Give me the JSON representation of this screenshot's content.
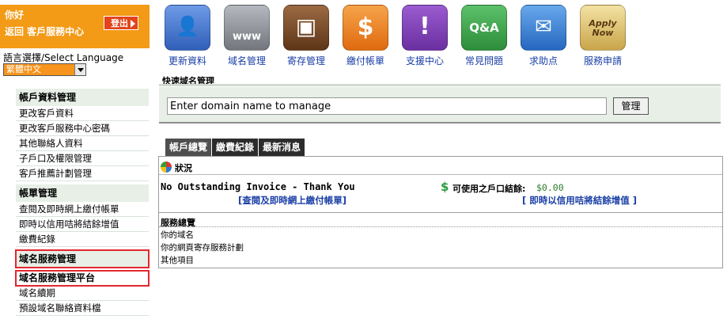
{
  "welcome": {
    "hello": "你好",
    "back_label": "返回 客戶服務中心",
    "logout_label": "登出"
  },
  "language": {
    "label": "語言選擇/Select Language",
    "selected": "繁體中文"
  },
  "sidebar": {
    "sections": [
      {
        "header": "帳戶資料管理",
        "items": [
          "更改客戶資料",
          "更改客戶服務中心密碼",
          "其他聯絡人資料",
          "子戶口及權限管理",
          "客戶推薦計劃管理"
        ]
      },
      {
        "header": "帳單管理",
        "items": [
          "查閱及即時網上繳付帳單",
          "即時以信用咭將結餘增值",
          "繳費紀錄"
        ]
      },
      {
        "header": "域名服務管理",
        "items": [
          "域名服務管理平台",
          "域名續期",
          "預設域名聯絡資料檔"
        ]
      }
    ]
  },
  "toolbar": {
    "icons": [
      {
        "label": "更新資料",
        "icon": "contacts-book-icon",
        "color": "#3b6fd1"
      },
      {
        "label": "域名管理",
        "icon": "globe-www-icon",
        "color": "#8a8f96"
      },
      {
        "label": "寄存管理",
        "icon": "server-box-icon",
        "color": "#7a4a2a"
      },
      {
        "label": "繳付帳單",
        "icon": "dollar-bill-icon",
        "color": "#ef7d1a"
      },
      {
        "label": "支援中心",
        "icon": "exclamation-icon",
        "color": "#7b3fb3"
      },
      {
        "label": "常見問題",
        "icon": "qa-bubble-icon",
        "color": "#3aa14a"
      },
      {
        "label": "求助点",
        "icon": "help-mail-icon",
        "color": "#2f7bd6"
      },
      {
        "label": "服務申請",
        "icon": "apply-now-icon",
        "color": "#d9b85a"
      }
    ],
    "glyphs": [
      "👤",
      "www",
      "▣",
      "$",
      "!",
      "Q&A",
      "✉",
      "Apply Now"
    ]
  },
  "quick_domain": {
    "title": "快速域名管理",
    "input_value": "Enter domain name to manage",
    "button_label": "管理"
  },
  "tabs": [
    "帳戶總覽",
    "繳費紀錄",
    "最新消息"
  ],
  "status": {
    "title": "狀況",
    "no_invoice": "No Outstanding Invoice - Thank You",
    "pay_link": "[查閱及即時網上繳付帳單]",
    "credit_label": "可使用之戶口結餘:",
    "credit_value": "$0.00",
    "credit_link": "[ 即時以信用咭將結餘增值 ]"
  },
  "services": {
    "header": "服務總覽",
    "rows": [
      "你的域名",
      "你的網頁寄存服務計劃",
      "其他項目"
    ]
  },
  "colors": {
    "accent_orange": "#f39a16",
    "logout_red": "#e2441b",
    "link_blue": "#1a3fa6",
    "sidebar_bg": "#e7efe7",
    "highlight_red": "#e5262f"
  }
}
